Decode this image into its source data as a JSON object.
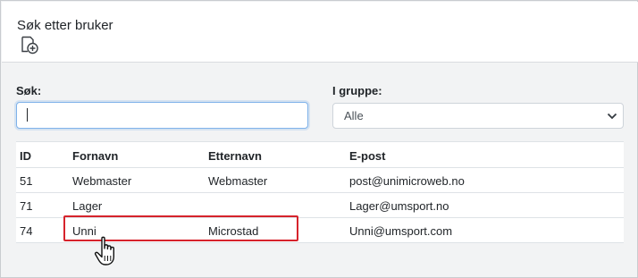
{
  "dialog": {
    "title": "Søk etter bruker",
    "add_icon": "user-add-icon"
  },
  "search": {
    "label": "Søk:",
    "value": "",
    "placeholder": ""
  },
  "group": {
    "label": "I gruppe:",
    "selected": "Alle"
  },
  "table": {
    "headers": [
      "ID",
      "Fornavn",
      "Etternavn",
      "E-post"
    ],
    "rows": [
      {
        "id": "51",
        "first": "Webmaster",
        "last": "Webmaster",
        "email": "post@unimicroweb.no"
      },
      {
        "id": "71",
        "first": "Lager",
        "last": "",
        "email": "Lager@umsport.no"
      },
      {
        "id": "74",
        "first": "Unni",
        "last": "Microstad",
        "email": "Unni@umsport.com"
      }
    ]
  },
  "colors": {
    "highlight_border": "#d6232c",
    "focus_border": "#7fb2ea"
  },
  "icons": {
    "select_chevron": "chevron-down-icon",
    "pointer": "hand-pointer-icon"
  }
}
